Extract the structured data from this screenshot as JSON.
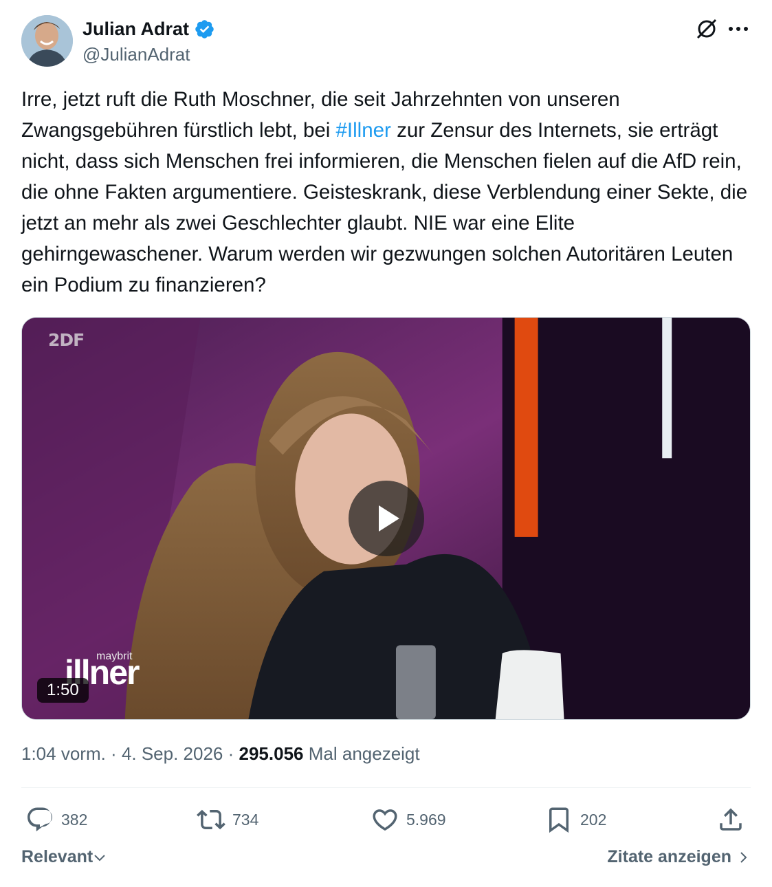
{
  "author": {
    "display_name": "Julian Adrat",
    "handle": "@JulianAdrat",
    "verified": true
  },
  "tweet": {
    "text_before": "Irre, jetzt ruft die Ruth Moschner, die seit Jahrzehnten von unseren Zwangsgebühren fürstlich lebt, bei ",
    "hashtag": "#Illner",
    "text_after": " zur Zensur des Internets, sie erträgt nicht, dass sich Menschen frei informieren, die Menschen fielen auf die AfD rein, die ohne Fakten argumentiere. Geisteskrank, diese Verblendung einer Sekte, die jetzt an mehr als zwei Geschlechter glaubt. NIE war eine Elite gehirngewaschener. Warum werden wir gezwungen solchen Autoritären Leuten ein Podium zu finanzieren?"
  },
  "video": {
    "duration": "1:50",
    "channel_logo": "2DF",
    "show_logo_sub": "maybrit",
    "show_logo_main": "illner"
  },
  "meta": {
    "time": "1:04 vorm.",
    "separator": " · ",
    "date": "4. Sep. 2026",
    "views": "295.056",
    "views_label": "Mal angezeigt"
  },
  "actions": {
    "replies": "382",
    "reposts": "734",
    "likes": "5.969",
    "bookmarks": "202"
  },
  "footer": {
    "sort_label": "Relevant",
    "quotes_label": "Zitate anzeigen"
  },
  "colors": {
    "accent": "#1d9bf0",
    "secondary_text": "#536471",
    "primary_text": "#0f1419"
  },
  "icons": [
    "verified-badge-icon",
    "grok-icon",
    "more-icon",
    "play-icon",
    "reply-icon",
    "repost-icon",
    "like-icon",
    "bookmark-icon",
    "share-icon",
    "chevron-down-icon",
    "chevron-right-icon"
  ]
}
